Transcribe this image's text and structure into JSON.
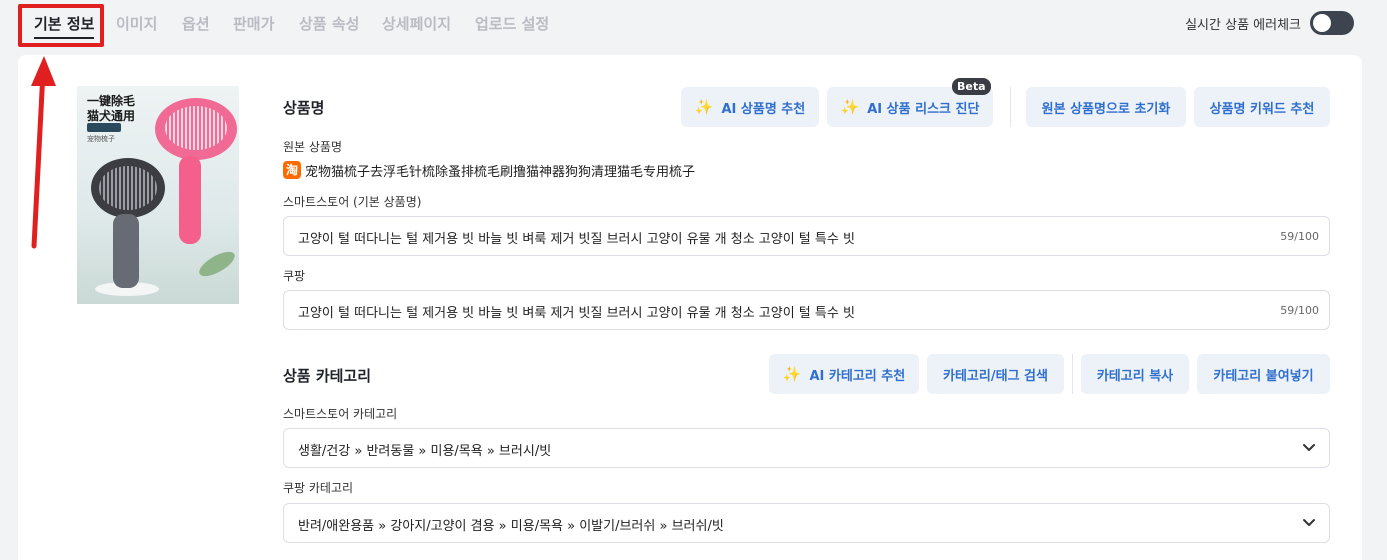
{
  "tabs": [
    {
      "label": "기본 정보",
      "active": true
    },
    {
      "label": "이미지",
      "active": false
    },
    {
      "label": "옵션",
      "active": false
    },
    {
      "label": "판매가",
      "active": false
    },
    {
      "label": "상품 속성",
      "active": false
    },
    {
      "label": "상세페이지",
      "active": false
    },
    {
      "label": "업로드 설정",
      "active": false
    }
  ],
  "realtime_check": {
    "label": "실시간 상품 에러체크",
    "enabled": false
  },
  "thumbnail": {
    "line1": "一键除毛",
    "line2": "猫犬通用",
    "line3": "宠物梳子"
  },
  "product_name": {
    "title": "상품명",
    "buttons": {
      "ai_recommend": "AI 상품명 추천",
      "ai_risk": "AI 상품 리스크 진단",
      "beta": "Beta",
      "reset": "원본 상품명으로 초기화",
      "keyword": "상품명 키워드 추천"
    },
    "original_label": "원본 상품명",
    "original_source_icon": "淘",
    "original_value": "宠物猫梳子去浮毛针梳除蚤排梳毛刷撸猫神器狗狗清理猫毛专用梳子",
    "smartstore_label": "스마트스토어 (기본 상품명)",
    "smartstore_value": "고양이 털 떠다니는 털 제거용 빗 바늘 빗 벼룩 제거 빗질 브러시 고양이 유물 개 청소 고양이 털 특수 빗",
    "smartstore_count": "59/100",
    "coupang_label": "쿠팡",
    "coupang_value": "고양이 털 떠다니는 털 제거용 빗 바늘 빗 벼룩 제거 빗질 브러시 고양이 유물 개 청소 고양이 털 특수 빗",
    "coupang_count": "59/100"
  },
  "category": {
    "title": "상품 카테고리",
    "buttons": {
      "ai_recommend": "AI 카테고리 추천",
      "search": "카테고리/태그 검색",
      "copy": "카테고리 복사",
      "paste": "카테고리 붙여넣기"
    },
    "smartstore_label": "스마트스토어 카테고리",
    "smartstore_value": "생활/건강 » 반려동물 » 미용/목욕 » 브러시/빗",
    "coupang_label": "쿠팡 카테고리",
    "coupang_value": "반려/애완용품 » 강아지/고양이 겸용 » 미용/목욕 » 이발기/브러쉬 » 브러쉬/빗"
  }
}
